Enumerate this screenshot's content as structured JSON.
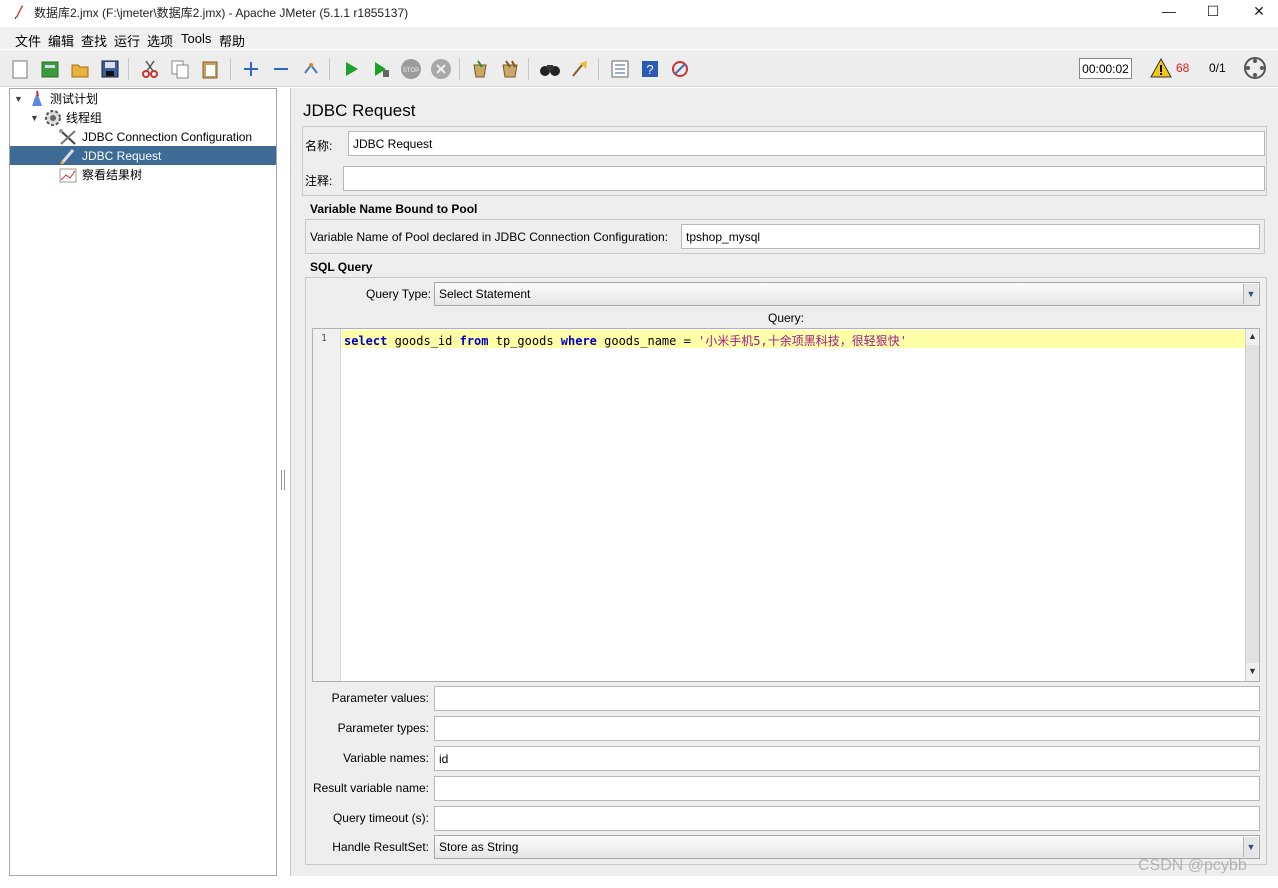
{
  "window": {
    "title": "数据库2.jmx (F:\\jmeter\\数据库2.jmx) - Apache JMeter (5.1.1 r1855137)",
    "minimize_label": "—",
    "maximize_label": "☐",
    "close_label": "✕"
  },
  "menu": [
    "文件",
    "编辑",
    "查找",
    "运行",
    "选项",
    "Tools",
    "帮助"
  ],
  "toolbar": {
    "icons": [
      "new-icon",
      "templates-icon",
      "open-icon",
      "save-icon",
      "cut-icon",
      "copy-icon",
      "paste-icon",
      "expand-icon",
      "collapse-icon",
      "toggle-icon",
      "start-icon",
      "start-no-pause-icon",
      "stop-icon",
      "shutdown-icon",
      "clear-icon",
      "clear-all-icon",
      "search-icon",
      "reset-search-icon",
      "function-helper-icon",
      "help-icon",
      "remote-icon"
    ],
    "timer": "00:00:02",
    "warning_count": "68",
    "threads": "0/1"
  },
  "tree": [
    {
      "label": "测试计划",
      "icon": "test-plan-icon",
      "level": 0,
      "expanded": true
    },
    {
      "label": "线程组",
      "icon": "thread-group-icon",
      "level": 1,
      "expanded": true
    },
    {
      "label": "JDBC Connection Configuration",
      "icon": "config-wrench-icon",
      "level": 2
    },
    {
      "label": "JDBC Request",
      "icon": "sampler-pen-icon",
      "level": 2,
      "selected": true
    },
    {
      "label": "察看结果树",
      "icon": "listener-graph-icon",
      "level": 2
    }
  ],
  "panel": {
    "title": "JDBC Request",
    "name_label": "名称:",
    "name_value": "JDBC Request",
    "comment_label": "注释:",
    "comment_value": "",
    "pool_section": "Variable Name Bound to Pool",
    "pool_label": "Variable Name of Pool declared in JDBC Connection Configuration:",
    "pool_value": "tpshop_mysql",
    "sql_section": "SQL Query",
    "query_type_label": "Query Type:",
    "query_type_value": "Select Statement",
    "query_label": "Query:",
    "query_line_number": "1",
    "query_tokens": {
      "t1": "select",
      "t2": " goods_id ",
      "t3": "from",
      "t4": " tp_goods ",
      "t5": "where",
      "t6": " goods_name = ",
      "t7": "'小米手机5,十余项黑科技，很轻狠快'"
    },
    "params": [
      {
        "label": "Parameter values:",
        "value": ""
      },
      {
        "label": "Parameter types:",
        "value": ""
      },
      {
        "label": "Variable names:",
        "value": "id"
      },
      {
        "label": "Result variable name:",
        "value": ""
      },
      {
        "label": "Query timeout (s):",
        "value": ""
      }
    ],
    "handle_label": "Handle ResultSet:",
    "handle_value": "Store as String"
  },
  "watermark": "CSDN @pcybb",
  "colors": {
    "selection": "#3e6a96",
    "query_line_highlight": "#ffffa8",
    "keyword": "#0000cc",
    "string": "#a2198e",
    "warning": "#e02020"
  }
}
